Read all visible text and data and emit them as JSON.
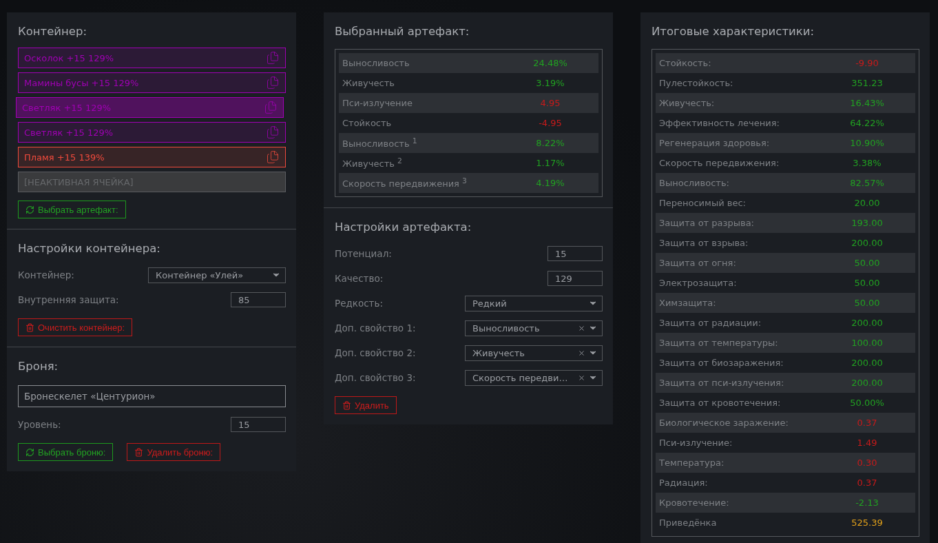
{
  "container_panel": {
    "title": "Контейнер:",
    "slots": [
      {
        "kind": "artifact",
        "label": "Осколок +15 129%",
        "color": "#a000b4",
        "selected": false
      },
      {
        "kind": "artifact",
        "label": "Мамины бусы +15 129%",
        "color": "#a000b4",
        "selected": false
      },
      {
        "kind": "artifact",
        "label": "Светляк +15 129%",
        "color": "#a000b4",
        "selected": true
      },
      {
        "kind": "artifact",
        "label": "Светляк +15 129%",
        "color": "#a000b4",
        "selected": false
      },
      {
        "kind": "artifact",
        "label": "Пламя +15 139%",
        "color": "#f04a3c",
        "selected": false
      },
      {
        "kind": "inactive",
        "label": "[НЕАКТИВНАЯ ЯЧЕЙКА]"
      }
    ],
    "button": {
      "kind": "select",
      "label": "Выбрать артефакт:"
    }
  },
  "container_settings": {
    "title": "Настройки контейнера:",
    "fields": [
      {
        "kind": "select",
        "label": "Контейнер:",
        "value": "Контейнер «Улей»",
        "clearable": false
      },
      {
        "kind": "input",
        "label": "Внутренняя защита:",
        "value": "85"
      }
    ],
    "button": {
      "kind": "delete",
      "label": "Очистить контейнер:"
    }
  },
  "armor": {
    "title": "Броня:",
    "name_value": "Бронескелет «Центурион»",
    "fields": [
      {
        "kind": "input",
        "label": "Уровень:",
        "value": "15"
      }
    ],
    "buttons": [
      {
        "kind": "select",
        "label": "Выбрать броню:"
      },
      {
        "kind": "delete",
        "label": "Удалить броню:"
      }
    ]
  },
  "selected_artifact": {
    "title": "Выбранный артефакт:",
    "stats": [
      {
        "label": "Выносливость",
        "value": "24.48%",
        "kind": "positive"
      },
      {
        "label": "Живучесть",
        "value": "3.19%",
        "kind": "positive"
      },
      {
        "label": "Пси-излучение",
        "value": "4.95",
        "kind": "negative"
      },
      {
        "label": "Стойкость",
        "value": "-4.95",
        "kind": "negative"
      },
      {
        "label": "Выносливость $^{1}$",
        "value": "8.22%",
        "kind": "positive"
      },
      {
        "label": "Живучесть $^{2}$",
        "value": "1.17%",
        "kind": "positive"
      },
      {
        "label": "Скорость передвижения $^{3}$",
        "value": "4.19%",
        "kind": "positive"
      }
    ]
  },
  "artifact_settings": {
    "title": "Настройки артефакта:",
    "fields": [
      {
        "kind": "input",
        "label": "Потенциал:",
        "value": "15"
      },
      {
        "kind": "input",
        "label": "Качество:",
        "value": "129"
      },
      {
        "kind": "select",
        "label": "Редкость:",
        "value": "Редкий",
        "clearable": false
      },
      {
        "kind": "select",
        "label": "Доп. свойство 1:",
        "value": "Выносливость",
        "clearable": true
      },
      {
        "kind": "select",
        "label": "Доп. свойство 2:",
        "value": "Живучесть",
        "clearable": true
      },
      {
        "kind": "select",
        "label": "Доп. свойство 3:",
        "value": "Скорость передви…",
        "clearable": true
      }
    ],
    "button": {
      "kind": "delete",
      "label": "Удалить"
    }
  },
  "totals": {
    "title": "Итоговые характеристики:",
    "stats": [
      {
        "label": "Стойкость:",
        "value": "-9.90",
        "kind": "negative"
      },
      {
        "label": "Пулестойкость:",
        "value": "351.23",
        "kind": "positive"
      },
      {
        "label": "Живучесть:",
        "value": "16.43%",
        "kind": "positive"
      },
      {
        "label": "Эффективность лечения:",
        "value": "64.22%",
        "kind": "positive"
      },
      {
        "label": "Регенерация здоровья:",
        "value": "10.90%",
        "kind": "positive"
      },
      {
        "label": "Скорость передвижения:",
        "value": "3.38%",
        "kind": "positive"
      },
      {
        "label": "Выносливость:",
        "value": "82.57%",
        "kind": "positive"
      },
      {
        "label": "Переносимый вес:",
        "value": "20.00",
        "kind": "positive"
      },
      {
        "label": "Защита от разрыва:",
        "value": "193.00",
        "kind": "positive"
      },
      {
        "label": "Защита от взрыва:",
        "value": "200.00",
        "kind": "positive"
      },
      {
        "label": "Защита от огня:",
        "value": "50.00",
        "kind": "positive"
      },
      {
        "label": "Электрозащита:",
        "value": "50.00",
        "kind": "positive"
      },
      {
        "label": "Химзащита:",
        "value": "50.00",
        "kind": "positive"
      },
      {
        "label": "Защита от радиации:",
        "value": "200.00",
        "kind": "positive"
      },
      {
        "label": "Защита от температуры:",
        "value": "100.00",
        "kind": "positive"
      },
      {
        "label": "Защита от биозаражения:",
        "value": "200.00",
        "kind": "positive"
      },
      {
        "label": "Защита от пси-излучения:",
        "value": "200.00",
        "kind": "positive"
      },
      {
        "label": "Защита от кровотечения:",
        "value": "50.00%",
        "kind": "positive"
      },
      {
        "label": "Биологическое заражение:",
        "value": "0.37",
        "kind": "negative"
      },
      {
        "label": "Пси-излучение:",
        "value": "1.49",
        "kind": "negative"
      },
      {
        "label": "Температура:",
        "value": "0.30",
        "kind": "negative"
      },
      {
        "label": "Радиация:",
        "value": "0.37",
        "kind": "negative"
      },
      {
        "label": "Кровотечение:",
        "value": "-2.13",
        "kind": "positive"
      },
      {
        "label": "Приведёнка",
        "value": "525.39",
        "kind": "highlight"
      }
    ]
  }
}
